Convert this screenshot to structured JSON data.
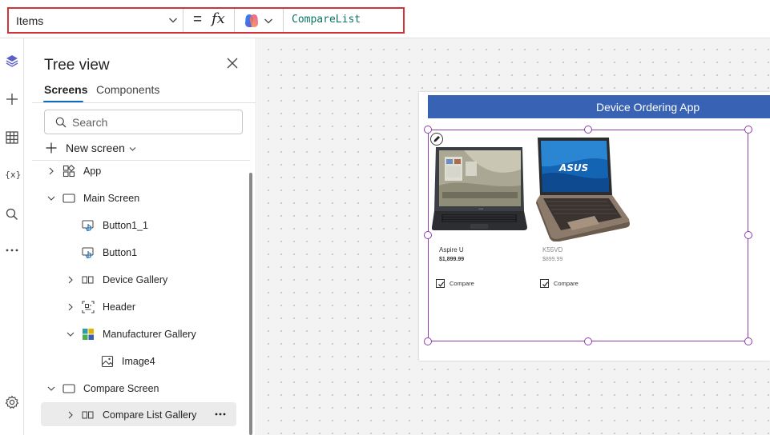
{
  "formula_bar": {
    "property": "Items",
    "equals": "=",
    "fx": "fx",
    "formula": "CompareList"
  },
  "left_rail": {
    "icons": [
      "layers-icon",
      "plus-icon",
      "table-icon",
      "variables-icon",
      "search-icon",
      "more-icon",
      "settings-icon"
    ]
  },
  "tree_view": {
    "title": "Tree view",
    "tabs": [
      {
        "label": "Screens",
        "active": true
      },
      {
        "label": "Components",
        "active": false
      }
    ],
    "search_placeholder": "Search",
    "new_screen_label": "New screen",
    "nodes": [
      {
        "label": "App",
        "icon": "app-icon",
        "expander": "chevron-right",
        "selected": false
      },
      {
        "label": "Main Screen",
        "icon": "screen-icon",
        "expander": "chevron-down",
        "selected": false
      },
      {
        "label": "Button1_1",
        "icon": "button-icon",
        "expander": "",
        "selected": false
      },
      {
        "label": "Button1",
        "icon": "button-icon",
        "expander": "",
        "selected": false
      },
      {
        "label": "Device Gallery",
        "icon": "gallery-icon",
        "expander": "chevron-right",
        "selected": false
      },
      {
        "label": "Header",
        "icon": "header-icon",
        "expander": "chevron-right",
        "selected": false
      },
      {
        "label": "Manufacturer Gallery",
        "icon": "colorful-gallery-icon",
        "expander": "chevron-down",
        "selected": false
      },
      {
        "label": "Image4",
        "icon": "image-icon",
        "expander": "",
        "selected": false
      },
      {
        "label": "Compare Screen",
        "icon": "screen-icon",
        "expander": "chevron-down",
        "selected": false
      },
      {
        "label": "Compare List Gallery",
        "icon": "gallery-icon",
        "expander": "chevron-right",
        "selected": true
      }
    ]
  },
  "canvas": {
    "app_title": "Device Ordering App",
    "products": [
      {
        "name": "Aspire U",
        "price": "$1,899.99",
        "checkbox_label": "Compare",
        "checked": true
      },
      {
        "name": "K55VD",
        "price": "$899.99",
        "checkbox_label": "Compare",
        "checked": true
      }
    ],
    "laptop_brand_text": "ASUS"
  },
  "colors": {
    "highlight_frame": "#d13438",
    "header_blue": "#3863b5",
    "selection_purple": "#8c3ea6",
    "formula_text": "#0b7466",
    "tab_underline": "#0f6cbd"
  }
}
